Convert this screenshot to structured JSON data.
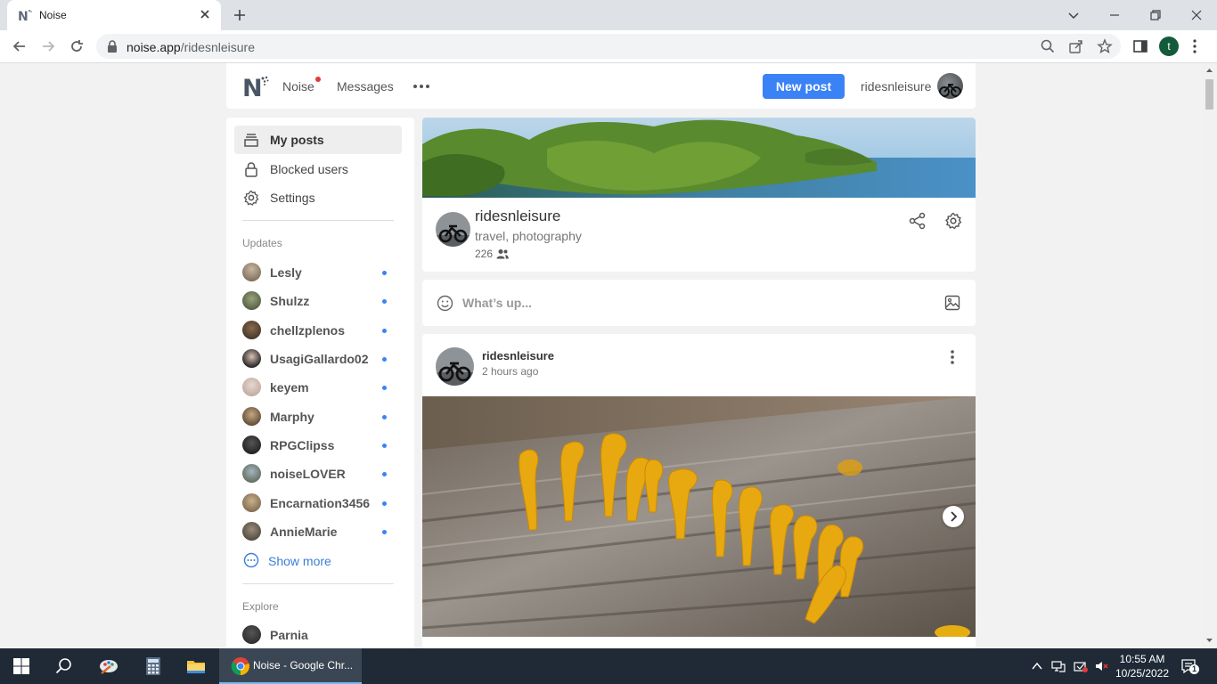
{
  "browser": {
    "tab_title": "Noise",
    "url_host": "noise.app",
    "url_path": "/ridesnleisure",
    "profile_initial": "t"
  },
  "header": {
    "nav_noise": "Noise",
    "nav_messages": "Messages",
    "new_post_label": "New post",
    "username": "ridesnleisure",
    "accent_color": "#3b82f6",
    "notification_dot_color": "#e53935"
  },
  "sidebar": {
    "menu": [
      {
        "label": "My posts",
        "icon": "archive-icon",
        "active": true
      },
      {
        "label": "Blocked users",
        "icon": "lock-icon",
        "active": false
      },
      {
        "label": "Settings",
        "icon": "gear-icon",
        "active": false
      }
    ],
    "updates_title": "Updates",
    "updates": [
      {
        "name": "Lesly"
      },
      {
        "name": "Shulzz"
      },
      {
        "name": "chellzplenos"
      },
      {
        "name": "UsagiGallardo02"
      },
      {
        "name": "keyem"
      },
      {
        "name": "Marphy"
      },
      {
        "name": "RPGClipss"
      },
      {
        "name": "noiseLOVER"
      },
      {
        "name": "Encarnation3456"
      },
      {
        "name": "AnnieMarie"
      }
    ],
    "show_more": "Show more",
    "explore_title": "Explore",
    "explore": [
      {
        "name": "Parnia"
      }
    ]
  },
  "profile": {
    "name": "ridesnleisure",
    "tags": "travel, photography",
    "followers": "226"
  },
  "compose": {
    "placeholder": "What’s up..."
  },
  "post": {
    "author": "ridesnleisure",
    "time": "2 hours ago"
  },
  "taskbar": {
    "chrome_label": "Noise - Google Chr...",
    "time": "10:55 AM",
    "date": "10/25/2022",
    "notification_count": "1"
  }
}
